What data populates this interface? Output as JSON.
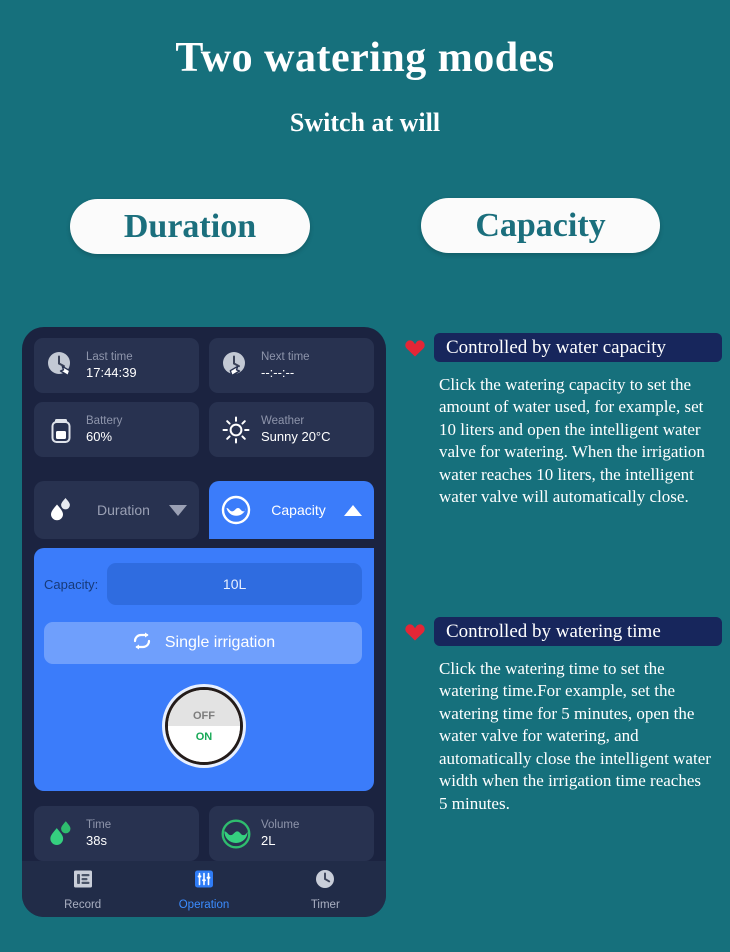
{
  "header": {
    "title": "Two watering modes",
    "subtitle": "Switch at will"
  },
  "mode_pills": [
    {
      "label": "Duration",
      "name": "pill-duration"
    },
    {
      "label": "Capacity",
      "name": "pill-capacity"
    }
  ],
  "colors": {
    "background": "#16707c",
    "pill_text": "#1b6f7d",
    "phone_body": "#1b2340",
    "card": "#283250",
    "accent_blue": "#3b7cfa",
    "badge_navy": "#17265c",
    "heart_red": "#e32636",
    "green": "#2eb872",
    "on_green": "#18a957"
  },
  "phone": {
    "info_cards": [
      {
        "icon": "clock-back-icon",
        "label": "Last time",
        "value": "17:44:39"
      },
      {
        "icon": "clock-forward-icon",
        "label": "Next time",
        "value": "--:--:--"
      },
      {
        "icon": "battery-icon",
        "label": "Battery",
        "value": "60%"
      },
      {
        "icon": "sun-icon",
        "label": "Weather",
        "value": "Sunny 20°C"
      }
    ],
    "tabs": [
      {
        "icon": "water-drops-icon",
        "label": "Duration",
        "arrow": "chevron-down-icon",
        "active": false
      },
      {
        "icon": "water-circle-icon",
        "label": "Capacity",
        "arrow": "chevron-up-icon",
        "active": true
      }
    ],
    "capacity_panel": {
      "field_label": "Capacity:",
      "field_value": "10L",
      "mode_button": {
        "icon": "repeat-icon",
        "label": "Single irrigation"
      },
      "power_knob": {
        "off_label": "OFF",
        "on_label": "ON"
      }
    },
    "stat_cards": [
      {
        "icon": "green-drops-icon",
        "label": "Time",
        "value": "38s"
      },
      {
        "icon": "green-volume-icon",
        "label": "Volume",
        "value": "2L"
      }
    ],
    "nav": [
      {
        "icon": "record-icon",
        "label": "Record",
        "active": false
      },
      {
        "icon": "sliders-icon",
        "label": "Operation",
        "active": true
      },
      {
        "icon": "clock-icon",
        "label": "Timer",
        "active": false
      }
    ]
  },
  "features": [
    {
      "heading": "Controlled by water capacity",
      "body": "Click the watering capacity to set the amount of water used, for example, set 10 liters and open the intelligent water valve for watering. When the irrigation water reaches 10 liters, the intelligent water valve will automatically close."
    },
    {
      "heading": "Controlled by watering time",
      "body": "Click the watering time to set the watering time.For example, set the watering time for 5 minutes, open the water valve for watering, and automatically close the intelligent water width when the irrigation time reaches 5 minutes."
    }
  ]
}
